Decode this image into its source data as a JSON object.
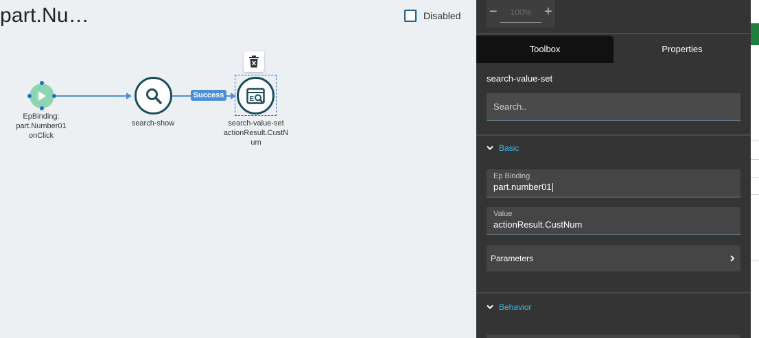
{
  "canvas": {
    "title": "part.Nu…",
    "disabled_label": "Disabled",
    "start_node": {
      "label_lines": [
        "EpBinding:",
        "part.Number01",
        "onClick"
      ]
    },
    "search_node": {
      "label": "search-show"
    },
    "edge_label": "Success",
    "value_set_node": {
      "label_lines": [
        "search-value-set",
        "actionResult.CustN",
        "um"
      ]
    }
  },
  "zoom": {
    "minus": "−",
    "value": "100%",
    "plus": "+"
  },
  "tabs": [
    {
      "label": "Toolbox",
      "active": true
    },
    {
      "label": "Properties",
      "active": false
    }
  ],
  "component_name": "search-value-set",
  "search": {
    "placeholder": "Search.."
  },
  "sections": {
    "basic": {
      "title": "Basic",
      "expanded": true
    },
    "behavior": {
      "title": "Behavior",
      "expanded": true
    }
  },
  "fields": {
    "ep_binding": {
      "label": "Ep Binding",
      "value": "part.number01"
    },
    "value": {
      "label": "Value",
      "value": "actionResult.CustNum"
    }
  },
  "parameters": {
    "label": "Parameters"
  },
  "colors": {
    "accent": "#3fb7e8",
    "panel": "#343434",
    "edge": "#4a90d9",
    "node_border": "#1a4d5c",
    "start_node": "#8fd4b1"
  }
}
